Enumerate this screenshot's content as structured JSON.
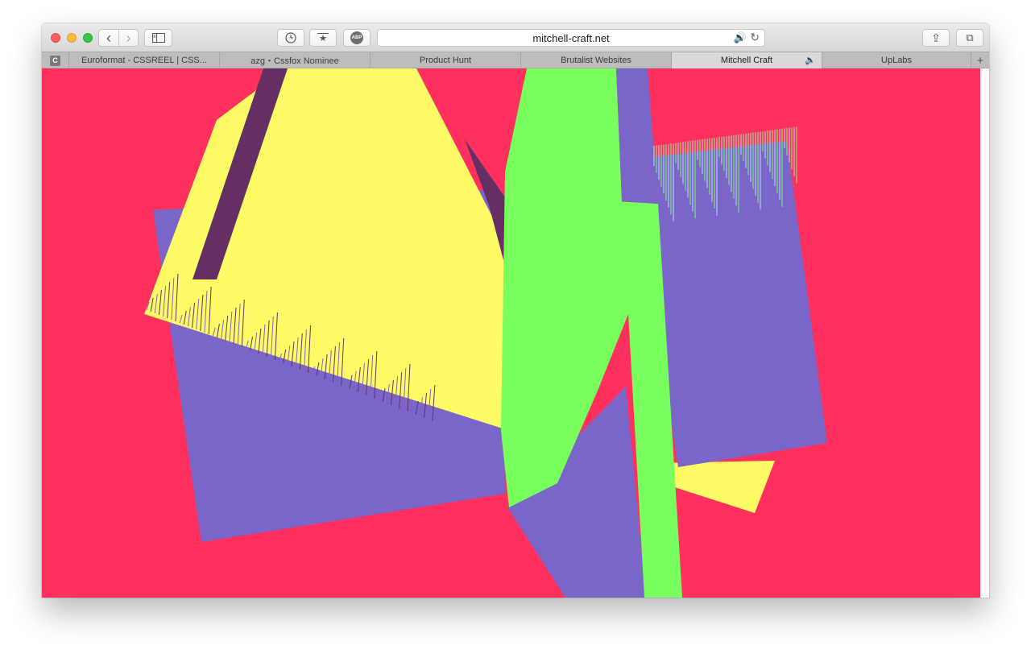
{
  "window": {
    "address": "mitchell-craft.net"
  },
  "toolbar": {
    "back_glyph": "‹",
    "forward_glyph": "›",
    "sidebar_icon": "sidebar-icon",
    "history_icon": "clock-icon",
    "bookmarks_glyph": "★",
    "abp_label": "ABP",
    "audio_glyph": "🔊",
    "reload_glyph": "↻",
    "share_glyph": "⇪",
    "tabs_glyph": "⧉"
  },
  "tabs": {
    "pinned_label": "C",
    "items": [
      {
        "label": "Euroformat - CSSREEL | CSS..."
      },
      {
        "label": "azg・Cssfox Nominee"
      },
      {
        "label": "Product Hunt"
      },
      {
        "label": "Brutalist Websites"
      },
      {
        "label": "Mitchell Craft",
        "active": true
      },
      {
        "label": "UpLabs"
      }
    ],
    "audio_glyph": "🔈",
    "new_tab_glyph": "+"
  },
  "content": {
    "colors": {
      "background": "#ff305d",
      "yellow": "#fffb66",
      "purple": "#7a65c8",
      "green": "#78ff5e",
      "dark_purple": "#652f64"
    }
  }
}
